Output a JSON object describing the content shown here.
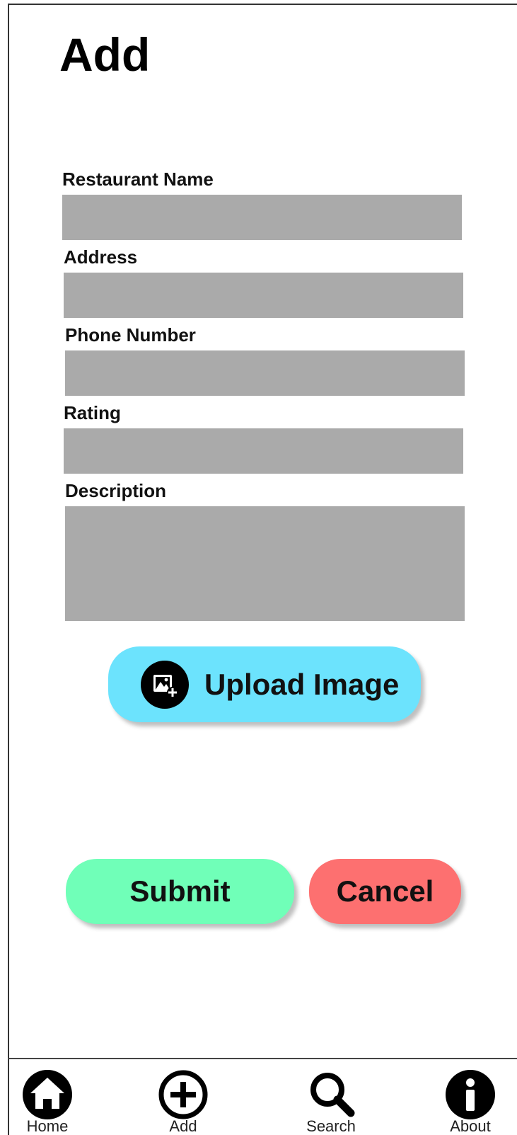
{
  "header": {
    "title": "Add"
  },
  "form": {
    "fields": [
      {
        "label": "Restaurant Name",
        "value": "",
        "placeholder": ""
      },
      {
        "label": "Address",
        "value": "",
        "placeholder": ""
      },
      {
        "label": "Phone Number",
        "value": "",
        "placeholder": ""
      },
      {
        "label": "Rating",
        "value": "",
        "placeholder": ""
      },
      {
        "label": "Description",
        "value": "",
        "placeholder": ""
      }
    ],
    "upload_label": "Upload Image",
    "submit_label": "Submit",
    "cancel_label": "Cancel"
  },
  "colors": {
    "field_bg": "#aaaaaa",
    "upload_bg": "#6ce3fd",
    "submit_bg": "#70ffb8",
    "cancel_bg": "#fd7070"
  },
  "nav": {
    "items": [
      {
        "label": "Home",
        "icon": "home-icon"
      },
      {
        "label": "Add",
        "icon": "add-circle-icon"
      },
      {
        "label": "Search",
        "icon": "search-icon"
      },
      {
        "label": "About",
        "icon": "info-icon"
      }
    ]
  }
}
